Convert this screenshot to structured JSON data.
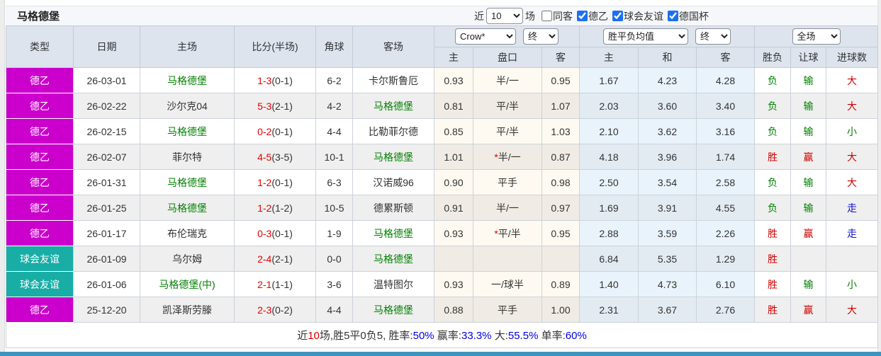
{
  "header": {
    "team_title": "马格德堡",
    "recent_prefix": "近",
    "recent_value": "10",
    "recent_suffix": "场",
    "filters": [
      {
        "label": "同客",
        "checked": false
      },
      {
        "label": "德乙",
        "checked": true
      },
      {
        "label": "球会友谊",
        "checked": true
      },
      {
        "label": "德国杯",
        "checked": true
      }
    ]
  },
  "table": {
    "columns": [
      "类型",
      "日期",
      "主场",
      "比分(半场)",
      "角球",
      "客场"
    ],
    "odds_group": {
      "select_bookmaker": "Crow*",
      "select_final": "终",
      "sub": [
        "主",
        "盘口",
        "客"
      ]
    },
    "avg_group": {
      "select_type": "胜平负均值",
      "select_final": "终",
      "sub": [
        "主",
        "和",
        "客"
      ]
    },
    "result_group": {
      "select_scope": "全场",
      "sub": [
        "胜负",
        "让球",
        "进球数"
      ]
    },
    "type_colors": {
      "德乙": "#CC00CC",
      "球会友谊": "#18ADA5"
    },
    "rows": [
      {
        "type": "德乙",
        "date": "26-03-01",
        "home": {
          "text": "马格德堡",
          "green": true
        },
        "score": {
          "main": "1-3",
          "half": "(0-1)"
        },
        "corner": "6-2",
        "away": {
          "text": "卡尔斯鲁厄",
          "green": false
        },
        "odds_home": "0.93",
        "handicap": {
          "star": false,
          "text": "半/一"
        },
        "odds_away": "0.95",
        "avg": [
          "1.67",
          "4.23",
          "4.28"
        ],
        "outcome": {
          "text": "负",
          "color": "green"
        },
        "spread": {
          "text": "输",
          "color": "green"
        },
        "goals": {
          "text": "大",
          "color": "red"
        }
      },
      {
        "type": "德乙",
        "date": "26-02-22",
        "home": {
          "text": "沙尔克04",
          "green": false
        },
        "score": {
          "main": "5-3",
          "half": "(2-1)"
        },
        "corner": "4-2",
        "away": {
          "text": "马格德堡",
          "green": true
        },
        "odds_home": "0.81",
        "handicap": {
          "star": false,
          "text": "平/半"
        },
        "odds_away": "1.07",
        "avg": [
          "2.03",
          "3.60",
          "3.40"
        ],
        "outcome": {
          "text": "负",
          "color": "green"
        },
        "spread": {
          "text": "输",
          "color": "green"
        },
        "goals": {
          "text": "大",
          "color": "red"
        }
      },
      {
        "type": "德乙",
        "date": "26-02-15",
        "home": {
          "text": "马格德堡",
          "green": true
        },
        "score": {
          "main": "0-2",
          "half": "(0-1)"
        },
        "corner": "4-4",
        "away": {
          "text": "比勒菲尔德",
          "green": false
        },
        "odds_home": "0.85",
        "handicap": {
          "star": false,
          "text": "平/半"
        },
        "odds_away": "1.03",
        "avg": [
          "2.10",
          "3.62",
          "3.16"
        ],
        "outcome": {
          "text": "负",
          "color": "green"
        },
        "spread": {
          "text": "输",
          "color": "green"
        },
        "goals": {
          "text": "小",
          "color": "green"
        }
      },
      {
        "type": "德乙",
        "date": "26-02-07",
        "home": {
          "text": "菲尔特",
          "green": false
        },
        "score": {
          "main": "4-5",
          "half": "(3-5)"
        },
        "corner": "10-1",
        "away": {
          "text": "马格德堡",
          "green": true
        },
        "odds_home": "1.01",
        "handicap": {
          "star": true,
          "text": "半/一"
        },
        "odds_away": "0.87",
        "avg": [
          "4.18",
          "3.96",
          "1.74"
        ],
        "outcome": {
          "text": "胜",
          "color": "red"
        },
        "spread": {
          "text": "赢",
          "color": "red"
        },
        "goals": {
          "text": "大",
          "color": "red"
        }
      },
      {
        "type": "德乙",
        "date": "26-01-31",
        "home": {
          "text": "马格德堡",
          "green": true
        },
        "score": {
          "main": "1-2",
          "half": "(0-1)"
        },
        "corner": "6-3",
        "away": {
          "text": "汉诺威96",
          "green": false
        },
        "odds_home": "0.90",
        "handicap": {
          "star": false,
          "text": "平手"
        },
        "odds_away": "0.98",
        "avg": [
          "2.50",
          "3.54",
          "2.58"
        ],
        "outcome": {
          "text": "负",
          "color": "green"
        },
        "spread": {
          "text": "输",
          "color": "green"
        },
        "goals": {
          "text": "大",
          "color": "red"
        }
      },
      {
        "type": "德乙",
        "date": "26-01-25",
        "home": {
          "text": "马格德堡",
          "green": true
        },
        "score": {
          "main": "1-2",
          "half": "(1-2)"
        },
        "corner": "10-5",
        "away": {
          "text": "德累斯顿",
          "green": false
        },
        "odds_home": "0.91",
        "handicap": {
          "star": false,
          "text": "半/一"
        },
        "odds_away": "0.97",
        "avg": [
          "1.69",
          "3.91",
          "4.55"
        ],
        "outcome": {
          "text": "负",
          "color": "green"
        },
        "spread": {
          "text": "输",
          "color": "green"
        },
        "goals": {
          "text": "走",
          "color": "blue"
        }
      },
      {
        "type": "德乙",
        "date": "26-01-17",
        "home": {
          "text": "布伦瑞克",
          "green": false
        },
        "score": {
          "main": "0-3",
          "half": "(0-1)"
        },
        "corner": "1-9",
        "away": {
          "text": "马格德堡",
          "green": true
        },
        "odds_home": "0.93",
        "handicap": {
          "star": true,
          "text": "平/半"
        },
        "odds_away": "0.95",
        "avg": [
          "2.88",
          "3.59",
          "2.26"
        ],
        "outcome": {
          "text": "胜",
          "color": "red"
        },
        "spread": {
          "text": "赢",
          "color": "red"
        },
        "goals": {
          "text": "走",
          "color": "blue"
        }
      },
      {
        "type": "球会友谊",
        "date": "26-01-09",
        "home": {
          "text": "乌尔姆",
          "green": false
        },
        "score": {
          "main": "2-4",
          "half": "(2-1)"
        },
        "corner": "0-0",
        "away": {
          "text": "马格德堡",
          "green": true
        },
        "odds_home": "",
        "handicap": {
          "star": false,
          "text": ""
        },
        "odds_away": "",
        "avg": [
          "6.84",
          "5.35",
          "1.29"
        ],
        "outcome": {
          "text": "胜",
          "color": "red"
        },
        "spread": {
          "text": "",
          "color": "black"
        },
        "goals": {
          "text": "",
          "color": "black"
        }
      },
      {
        "type": "球会友谊",
        "date": "26-01-06",
        "home": {
          "text": "马格德堡(中)",
          "green": true
        },
        "score": {
          "main": "2-1",
          "half": "(1-1)"
        },
        "corner": "3-6",
        "away": {
          "text": "温特图尔",
          "green": false
        },
        "odds_home": "0.93",
        "handicap": {
          "star": false,
          "text": "一/球半"
        },
        "odds_away": "0.89",
        "avg": [
          "1.40",
          "4.73",
          "6.10"
        ],
        "outcome": {
          "text": "胜",
          "color": "red"
        },
        "spread": {
          "text": "输",
          "color": "green"
        },
        "goals": {
          "text": "小",
          "color": "green"
        }
      },
      {
        "type": "德乙",
        "date": "25-12-20",
        "home": {
          "text": "凯泽斯劳滕",
          "green": false
        },
        "score": {
          "main": "2-3",
          "half": "(0-2)"
        },
        "corner": "4-4",
        "away": {
          "text": "马格德堡",
          "green": true
        },
        "odds_home": "0.88",
        "handicap": {
          "star": false,
          "text": "平手"
        },
        "odds_away": "1.00",
        "avg": [
          "2.31",
          "3.67",
          "2.76"
        ],
        "outcome": {
          "text": "胜",
          "color": "red"
        },
        "spread": {
          "text": "赢",
          "color": "red"
        },
        "goals": {
          "text": "大",
          "color": "red"
        }
      }
    ]
  },
  "summary": {
    "segments": [
      {
        "text": "近",
        "color": "black"
      },
      {
        "text": "10",
        "color": "red"
      },
      {
        "text": "场,胜5平0负5, 胜率:",
        "color": "black"
      },
      {
        "text": "50%",
        "color": "blue"
      },
      {
        "text": " 赢率:",
        "color": "black"
      },
      {
        "text": "33.3%",
        "color": "blue"
      },
      {
        "text": " 大:",
        "color": "black"
      },
      {
        "text": "55.5%",
        "color": "blue"
      },
      {
        "text": " 单率:",
        "color": "black"
      },
      {
        "text": "60%",
        "color": "blue"
      }
    ]
  },
  "colors": {
    "badge_league": "#CC00CC",
    "badge_friendly": "#18ADA5",
    "home_team_green": "#008000",
    "score_red": "#E60000",
    "result_red": "#CC0000",
    "result_green": "#008000",
    "result_blue": "#1717CC",
    "summary_blue": "#0000E6",
    "header_bg": "#DDE4EE",
    "avg_col_bg": "#E9F3FB",
    "checkbox_accent": "#1D6FF2",
    "bottom_bar": "#3D95BF"
  }
}
